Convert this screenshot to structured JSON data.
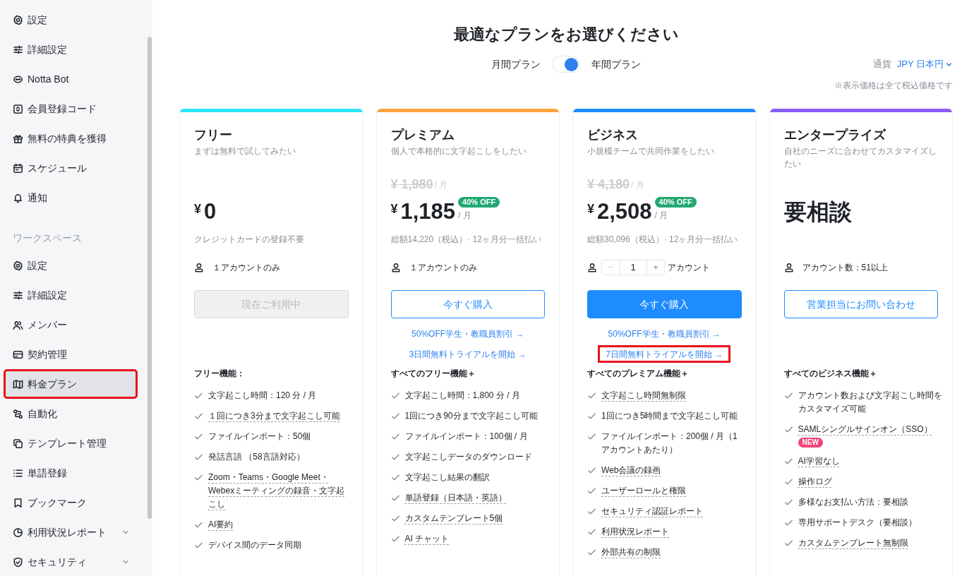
{
  "sidebar": {
    "groups": [
      {
        "items": [
          {
            "label": "設定",
            "selected": false,
            "highlighted": false
          },
          {
            "label": "詳細設定",
            "selected": false,
            "highlighted": false
          },
          {
            "label": "Notta Bot",
            "selected": false,
            "highlighted": false
          },
          {
            "label": "会員登録コード",
            "selected": false,
            "highlighted": false
          },
          {
            "label": "無料の特典を獲得",
            "selected": false,
            "highlighted": false
          },
          {
            "label": "スケジュール",
            "selected": false,
            "highlighted": false
          },
          {
            "label": "通知",
            "selected": false,
            "highlighted": false
          }
        ]
      },
      {
        "label": "ワークスペース",
        "items": [
          {
            "label": "設定",
            "selected": false,
            "highlighted": false
          },
          {
            "label": "詳細設定",
            "selected": false,
            "highlighted": false
          },
          {
            "label": "メンバー",
            "selected": false,
            "highlighted": false
          },
          {
            "label": "契約管理",
            "selected": false,
            "highlighted": false
          },
          {
            "label": "料金プラン",
            "selected": true,
            "highlighted": true
          },
          {
            "label": "自動化",
            "selected": false,
            "highlighted": false
          },
          {
            "label": "テンプレート管理",
            "selected": false,
            "highlighted": false
          },
          {
            "label": "単語登録",
            "selected": false,
            "highlighted": false
          },
          {
            "label": "ブックマーク",
            "selected": false,
            "highlighted": false
          },
          {
            "label": "利用状況レポート",
            "selected": false,
            "highlighted": false,
            "expanded": false
          },
          {
            "label": "セキュリティ",
            "selected": false,
            "highlighted": false,
            "expanded": false
          }
        ]
      }
    ]
  },
  "header": {
    "title": "最適なプランをお選びください",
    "billing_toggle": {
      "left_label": "月間プラン",
      "right_label": "年間プラン",
      "on": true
    },
    "currency": {
      "label": "通貨",
      "value": "JPY 日本円"
    },
    "tax_note": "※表示価格は全て税込価格です"
  },
  "plans": [
    {
      "name": "フリー",
      "tagline": "まずは無料で試してみたい",
      "color": "#2ee6f7",
      "currency": "¥",
      "amount": "0",
      "price_note": "クレジットカードの登録不要",
      "accounts": {
        "kind": "text",
        "text": "１アカウントのみ"
      },
      "button": {
        "label": "現在ご利用中",
        "kind": "disabled"
      },
      "features_title": "フリー機能：",
      "features": [
        {
          "text": "文字起こし時間：120 分 / 月",
          "underlined": false
        },
        {
          "text": "１回につき3分まで文字起こし可能",
          "underlined": true
        },
        {
          "text": "ファイルインポート：50個",
          "underlined": false
        },
        {
          "text": "発話言語 （58言語対応）",
          "underlined": false
        },
        {
          "text": "Zoom・Teams・Google Meet・Webexミーティングの録音・文字起こし",
          "underlined": true
        },
        {
          "text": "AI要約",
          "underlined": true
        },
        {
          "text": "デバイス間のデータ同期",
          "underlined": false
        }
      ]
    },
    {
      "name": "プレミアム",
      "tagline": "個人で本格的に文字起こしをしたい",
      "color": "#ffa53f",
      "original_price": "¥ 1,980",
      "original_unit": "/ 月",
      "currency": "¥",
      "amount": "1,185",
      "unit": "/ 月",
      "discount_badge": "40% OFF",
      "price_note": "総額14,220（税込）· 12ヶ月分一括払い",
      "accounts": {
        "kind": "text",
        "text": "１アカウントのみ"
      },
      "button": {
        "label": "今すぐ購入",
        "kind": "outline"
      },
      "links": [
        {
          "label": "50%OFF学生・教職員割引 →",
          "highlighted": false
        },
        {
          "label": "3日間無料トライアルを開始 →",
          "highlighted": false
        }
      ],
      "features_title": "すべてのフリー機能＋",
      "features": [
        {
          "text": "文字起こし時間：1,800 分 / 月",
          "underlined": false
        },
        {
          "text": "1回につき90分まで文字起こし可能",
          "underlined": false
        },
        {
          "text": "ファイルインポート：100個 / 月",
          "underlined": false
        },
        {
          "text": "文字起こしデータのダウンロード",
          "underlined": false
        },
        {
          "text": "文字起こし結果の翻訳",
          "underlined": false
        },
        {
          "text": "単語登録（日本語・英語）",
          "underlined": true
        },
        {
          "text": "カスタムテンプレート5個",
          "underlined": true
        },
        {
          "text": "AI チャット",
          "underlined": true
        }
      ]
    },
    {
      "name": "ビジネス",
      "tagline": "小規模チームで共同作業をしたい",
      "color": "#1e8cff",
      "original_price": "¥ 4,180",
      "original_unit": "/ 月",
      "currency": "¥",
      "amount": "2,508",
      "unit": "/ 月",
      "discount_badge": "40% OFF",
      "price_note": "総額30,096（税込）· 12ヶ月分一括払い",
      "accounts": {
        "kind": "stepper",
        "minus": "−",
        "value": "1",
        "plus": "+",
        "text": "アカウント"
      },
      "button": {
        "label": "今すぐ購入",
        "kind": "primary"
      },
      "links": [
        {
          "label": "50%OFF学生・教職員割引 →",
          "highlighted": false
        },
        {
          "label": "7日間無料トライアルを開始 →",
          "highlighted": true
        }
      ],
      "features_title": "すべてのプレミアム機能＋",
      "features": [
        {
          "text": "文字起こし時間無制限",
          "underlined": true
        },
        {
          "text": "1回につき5時間まで文字起こし可能",
          "underlined": false
        },
        {
          "text": "ファイルインポート：200個 / 月（1アカウントあたり）",
          "underlined": false
        },
        {
          "text": "Web会議の録画",
          "underlined": true
        },
        {
          "text": "ユーザーロールと権限",
          "underlined": true
        },
        {
          "text": "セキュリティ認証レポート",
          "underlined": true
        },
        {
          "text": "利用状況レポート",
          "underlined": true
        },
        {
          "text": "外部共有の制限",
          "underlined": true
        }
      ]
    },
    {
      "name": "エンタープライズ",
      "tagline": "自社のニーズに合わせてカスタマイズしたい",
      "color": "#8b5cf6",
      "amount": "要相談",
      "accounts": {
        "kind": "text",
        "text": "アカウント数：51以上"
      },
      "button": {
        "label": "営業担当にお問い合わせ",
        "kind": "outline"
      },
      "features_title": "すべてのビジネス機能＋",
      "features": [
        {
          "text": "アカウント数および文字起こし時間をカスタマイズ可能",
          "underlined": false
        },
        {
          "text": "SAMLシングルサインオン（SSO）",
          "underlined": true,
          "badge": "NEW"
        },
        {
          "text": "AI学習なし",
          "underlined": true
        },
        {
          "text": "操作ログ",
          "underlined": true
        },
        {
          "text": "多様なお支払い方法：要相談",
          "underlined": false
        },
        {
          "text": "専用サポートデスク（要相談）",
          "underlined": false
        },
        {
          "text": "カスタムテンプレート無制限",
          "underlined": true
        }
      ]
    }
  ]
}
